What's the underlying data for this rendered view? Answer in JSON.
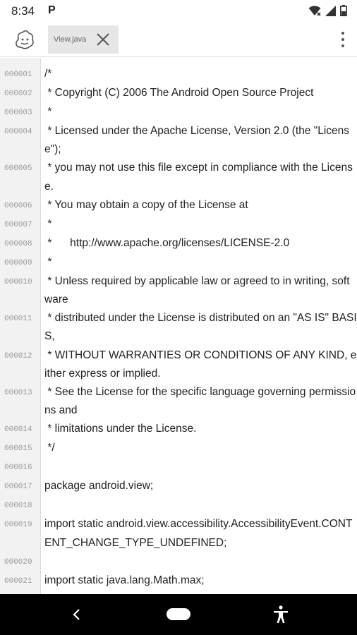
{
  "status": {
    "time": "8:34",
    "p_icon": "P"
  },
  "toolbar": {
    "tab_label": "View.java"
  },
  "editor": {
    "lines": [
      {
        "n": "000001",
        "t": "/*"
      },
      {
        "n": "000002",
        "t": " * Copyright (C) 2006 The Android Open Source Project"
      },
      {
        "n": "000003",
        "t": " *"
      },
      {
        "n": "000004",
        "t": " * Licensed under the Apache License, Version 2.0 (the \"License\");"
      },
      {
        "n": "000005",
        "t": " * you may not use this file except in compliance with the License."
      },
      {
        "n": "000006",
        "t": " * You may obtain a copy of the License at"
      },
      {
        "n": "000007",
        "t": " *"
      },
      {
        "n": "000008",
        "t": " *      http://www.apache.org/licenses/LICENSE-2.0"
      },
      {
        "n": "000009",
        "t": " *"
      },
      {
        "n": "000010",
        "t": " * Unless required by applicable law or agreed to in writing, software"
      },
      {
        "n": "000011",
        "t": " * distributed under the License is distributed on an \"AS IS\" BASIS,"
      },
      {
        "n": "000012",
        "t": " * WITHOUT WARRANTIES OR CONDITIONS OF ANY KIND, either express or implied."
      },
      {
        "n": "000013",
        "t": " * See the License for the specific language governing permissions and"
      },
      {
        "n": "000014",
        "t": " * limitations under the License."
      },
      {
        "n": "000015",
        "t": " */"
      },
      {
        "n": "000016",
        "t": ""
      },
      {
        "n": "000017",
        "t": "package android.view;"
      },
      {
        "n": "000018",
        "t": ""
      },
      {
        "n": "000019",
        "t": "import static android.view.accessibility.AccessibilityEvent.CONTENT_CHANGE_TYPE_UNDEFINED;"
      },
      {
        "n": "000020",
        "t": ""
      },
      {
        "n": "000021",
        "t": "import static java.lang.Math.max;"
      }
    ]
  },
  "icons": {
    "app": "app-logo-icon",
    "close": "close-icon",
    "overflow": "more-vert-icon",
    "wifi": "wifi-icon",
    "signal": "signal-icon",
    "battery": "battery-icon",
    "back": "back-icon",
    "home": "home-pill-icon",
    "accessibility": "accessibility-icon"
  }
}
